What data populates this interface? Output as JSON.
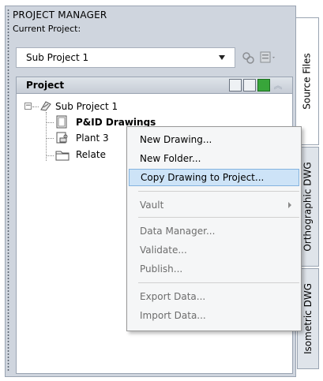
{
  "palette": {
    "title": "PROJECT MANAGER",
    "current_project_label": "Current Project:",
    "current_project_value": "Sub Project 1"
  },
  "panel": {
    "header": "Project"
  },
  "tree": {
    "root": "Sub Project 1",
    "children": [
      {
        "label": "P&ID Drawings",
        "icon": "pid-drawings-icon"
      },
      {
        "label": "Plant 3",
        "icon": "plant3d-icon"
      },
      {
        "label": "Relate",
        "icon": "folder-icon"
      }
    ]
  },
  "tabs": [
    {
      "label": "Source Files",
      "active": true
    },
    {
      "label": "Orthographic DWG",
      "active": false
    },
    {
      "label": "Isometric DWG",
      "active": false
    }
  ],
  "context_menu": {
    "items": [
      {
        "label": "New Drawing...",
        "enabled": true
      },
      {
        "label": "New Folder...",
        "enabled": true
      },
      {
        "label": "Copy Drawing to Project...",
        "enabled": true,
        "highlighted": true
      },
      {
        "label": "Vault",
        "enabled": false,
        "submenu": true
      },
      {
        "label": "Data Manager...",
        "enabled": false
      },
      {
        "label": "Validate...",
        "enabled": false
      },
      {
        "label": "Publish...",
        "enabled": false
      },
      {
        "label": "Export Data...",
        "enabled": false
      },
      {
        "label": "Import Data...",
        "enabled": false
      }
    ]
  },
  "colors": {
    "palette_bg": "#cfd5de",
    "highlight_bg": "#cde3f7",
    "highlight_border": "#84b3df"
  }
}
